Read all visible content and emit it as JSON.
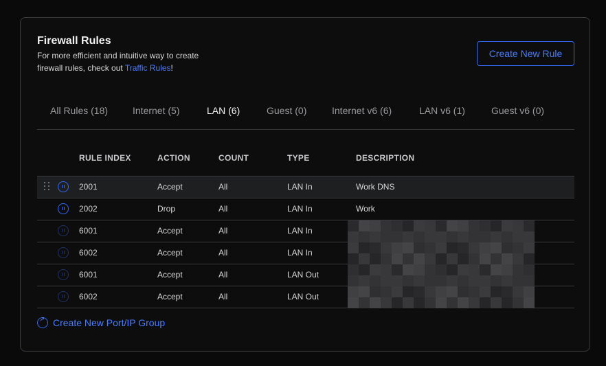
{
  "header": {
    "title": "Firewall Rules",
    "subtitle_text": "For more efficient and intuitive way to create firewall rules, check out ",
    "subtitle_link": "Traffic Rules",
    "subtitle_end": "!",
    "create_button": "Create New Rule"
  },
  "tabs": [
    {
      "label": "All Rules (18)",
      "active": false
    },
    {
      "label": "Internet (5)",
      "active": false
    },
    {
      "label": "LAN (6)",
      "active": true
    },
    {
      "label": "Guest (0)",
      "active": false
    },
    {
      "label": "Internet v6 (6)",
      "active": false
    },
    {
      "label": "LAN v6 (1)",
      "active": false
    },
    {
      "label": "Guest v6 (0)",
      "active": false
    }
  ],
  "table": {
    "headers": [
      "RULE INDEX",
      "ACTION",
      "COUNT",
      "TYPE",
      "DESCRIPTION"
    ],
    "rows": [
      {
        "index": "2001",
        "action": "Accept",
        "count": "All",
        "type": "LAN In",
        "description": "Work DNS",
        "enabled": true
      },
      {
        "index": "2002",
        "action": "Drop",
        "count": "All",
        "type": "LAN In",
        "description": "Work",
        "enabled": true
      },
      {
        "index": "6001",
        "action": "Accept",
        "count": "All",
        "type": "LAN In",
        "description": "",
        "enabled": false
      },
      {
        "index": "6002",
        "action": "Accept",
        "count": "All",
        "type": "LAN In",
        "description": "",
        "enabled": false
      },
      {
        "index": "6001",
        "action": "Accept",
        "count": "All",
        "type": "LAN Out",
        "description": "",
        "enabled": false
      },
      {
        "index": "6002",
        "action": "Accept",
        "count": "All",
        "type": "LAN Out",
        "description": "",
        "enabled": false
      }
    ]
  },
  "footer": {
    "create_group_link": "Create New Port/IP Group"
  },
  "colors": {
    "accent": "#3569f5",
    "background": "#0a0a0b",
    "border": "#3a3b3e"
  },
  "icons": {
    "drag": "drag-handle-icon",
    "status": "pause-circle-icon",
    "group": "external-link-icon"
  }
}
